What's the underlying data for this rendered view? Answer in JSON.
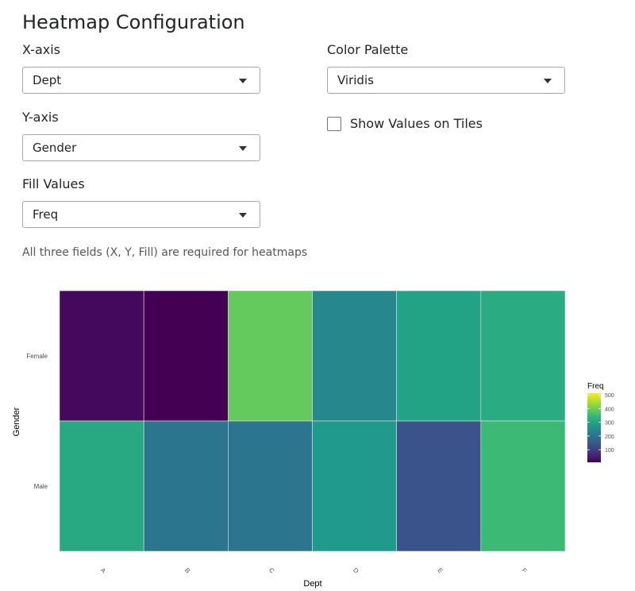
{
  "page": {
    "title": "Heatmap Configuration"
  },
  "form": {
    "x_axis": {
      "label": "X-axis",
      "value": "Dept"
    },
    "y_axis": {
      "label": "Y-axis",
      "value": "Gender"
    },
    "fill": {
      "label": "Fill Values",
      "value": "Freq"
    },
    "palette": {
      "label": "Color Palette",
      "value": "Viridis"
    },
    "show_values": {
      "label": "Show Values on Tiles",
      "checked": false
    },
    "help_text": "All three fields (X, Y, Fill) are required for heatmaps"
  },
  "chart_data": {
    "type": "heatmap",
    "xlabel": "Dept",
    "ylabel": "Gender",
    "x_categories": [
      "A",
      "B",
      "C",
      "D",
      "E",
      "F"
    ],
    "y_categories": [
      "Female",
      "Male"
    ],
    "values": [
      [
        19,
        8,
        391,
        244,
        299,
        317
      ],
      [
        313,
        207,
        205,
        279,
        138,
        351
      ]
    ],
    "legend": {
      "title": "Freq",
      "ticks": [
        100,
        200,
        300,
        400,
        500
      ],
      "range": [
        8,
        512
      ],
      "position": "right"
    },
    "palette": "viridis",
    "colors": [
      "#440154",
      "#482878",
      "#3e4989",
      "#31688e",
      "#26828e",
      "#1f9e89",
      "#35b779",
      "#6ece58",
      "#b5de2b",
      "#fde725"
    ]
  }
}
